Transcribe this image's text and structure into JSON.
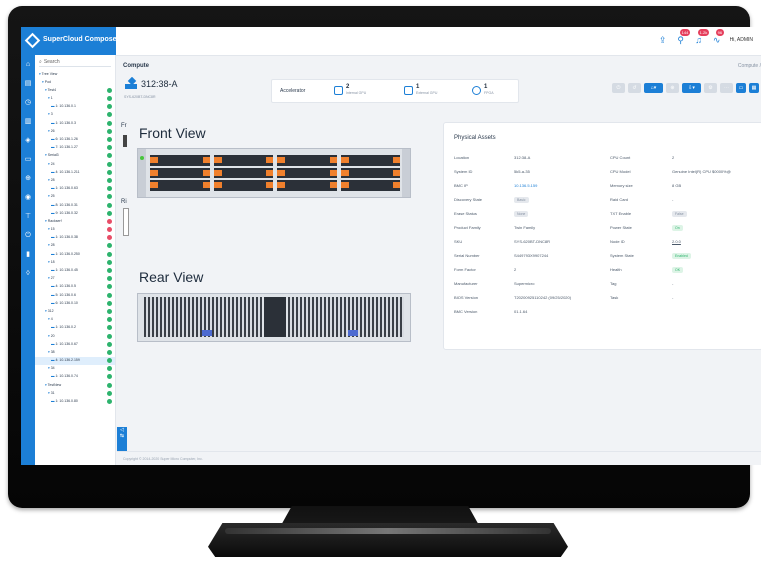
{
  "app": {
    "brand": "SuperCloud Composer",
    "user_label": "Hi, ADMIN"
  },
  "header_badges": {
    "alerts": "144",
    "notifications": "1.2k",
    "tasks": "96"
  },
  "nav_rail_icons": [
    "home-icon",
    "server-icon",
    "clock-icon",
    "report-icon",
    "cube-icon",
    "storage-icon",
    "network-icon",
    "database-icon",
    "switch-icon",
    "power-icon",
    "chart-icon",
    "shield-icon"
  ],
  "tree": {
    "search_placeholder": "Search",
    "items": [
      {
        "label": "Tree View",
        "indent": 0,
        "glyph": "▾",
        "status": "none"
      },
      {
        "label": "Pod",
        "indent": 1,
        "glyph": "▾",
        "status": "none"
      },
      {
        "label": "Test4",
        "indent": 2,
        "glyph": "▾",
        "status": "green"
      },
      {
        "label": "1",
        "indent": 3,
        "glyph": "▾",
        "status": "green"
      },
      {
        "label": "1: 10.136.0.1",
        "indent": 4,
        "glyph": "▬",
        "status": "green"
      },
      {
        "label": "3",
        "indent": 3,
        "glyph": "▾",
        "status": "green"
      },
      {
        "label": "1: 10.136.0.3",
        "indent": 4,
        "glyph": "▬",
        "status": "green"
      },
      {
        "label": "26",
        "indent": 3,
        "glyph": "▾",
        "status": "green"
      },
      {
        "label": "6: 10.136.1.26",
        "indent": 4,
        "glyph": "▬",
        "status": "green"
      },
      {
        "label": "7: 10.136.1.27",
        "indent": 4,
        "glyph": "▬",
        "status": "green"
      },
      {
        "label": "Serial3",
        "indent": 2,
        "glyph": "▾",
        "status": "green"
      },
      {
        "label": "24",
        "indent": 3,
        "glyph": "▾",
        "status": "green"
      },
      {
        "label": "4: 10.136.1.211",
        "indent": 4,
        "glyph": "▬",
        "status": "green"
      },
      {
        "label": "28",
        "indent": 3,
        "glyph": "▾",
        "status": "green"
      },
      {
        "label": "1: 10.136.0.63",
        "indent": 4,
        "glyph": "▬",
        "status": "green"
      },
      {
        "label": "25",
        "indent": 3,
        "glyph": "▾",
        "status": "green"
      },
      {
        "label": "8: 10.136.0.31",
        "indent": 4,
        "glyph": "▬",
        "status": "green"
      },
      {
        "label": "9: 10.136.0.32",
        "indent": 4,
        "glyph": "▬",
        "status": "green"
      },
      {
        "label": "Rackserf",
        "indent": 2,
        "glyph": "▾",
        "status": "red"
      },
      {
        "label": "15",
        "indent": 3,
        "glyph": "▾",
        "status": "red"
      },
      {
        "label": "1: 10.136.0.38",
        "indent": 4,
        "glyph": "▬",
        "status": "red"
      },
      {
        "label": "28",
        "indent": 3,
        "glyph": "▾",
        "status": "green"
      },
      {
        "label": "1: 10.136.0.250",
        "indent": 4,
        "glyph": "▬",
        "status": "green"
      },
      {
        "label": "18",
        "indent": 3,
        "glyph": "▾",
        "status": "green"
      },
      {
        "label": "1: 10.136.0.45",
        "indent": 4,
        "glyph": "▬",
        "status": "green"
      },
      {
        "label": "27",
        "indent": 3,
        "glyph": "▾",
        "status": "green"
      },
      {
        "label": "4: 10.136.0.5",
        "indent": 4,
        "glyph": "▬",
        "status": "green"
      },
      {
        "label": "5: 10.136.0.6",
        "indent": 4,
        "glyph": "▬",
        "status": "green"
      },
      {
        "label": "6: 10.136.0.10",
        "indent": 4,
        "glyph": "▬",
        "status": "green"
      },
      {
        "label": "312",
        "indent": 2,
        "glyph": "▾",
        "status": "green"
      },
      {
        "label": "4",
        "indent": 3,
        "glyph": "▾",
        "status": "green"
      },
      {
        "label": "1: 10.136.0.2",
        "indent": 4,
        "glyph": "▬",
        "status": "green"
      },
      {
        "label": "20",
        "indent": 3,
        "glyph": "▾",
        "status": "green"
      },
      {
        "label": "1: 10.136.0.67",
        "indent": 4,
        "glyph": "▬",
        "status": "green"
      },
      {
        "label": "38",
        "indent": 3,
        "glyph": "▾",
        "status": "green"
      },
      {
        "label": "4: 10.136.2.159",
        "indent": 4,
        "glyph": "▬",
        "status": "green",
        "selected": true
      },
      {
        "label": "34",
        "indent": 3,
        "glyph": "▾",
        "status": "green"
      },
      {
        "label": "1: 10.136.0.74",
        "indent": 4,
        "glyph": "▬",
        "status": "green"
      },
      {
        "label": "TestNew",
        "indent": 2,
        "glyph": "▾",
        "status": "green"
      },
      {
        "label": "31",
        "indent": 3,
        "glyph": "▾",
        "status": "green"
      },
      {
        "label": "1: 10.136.0.80",
        "indent": 4,
        "glyph": "▬",
        "status": "green"
      }
    ]
  },
  "main": {
    "section": "Compute",
    "breadcrumb": "Compute /",
    "node_name": "312:38-A",
    "node_sub": "SYS-620BT-DNC8R",
    "accelerator": {
      "label": "Accelerator",
      "items": [
        {
          "count": "2",
          "sub": "Internal GPU"
        },
        {
          "count": "1",
          "sub": "External GPU"
        },
        {
          "count": "1",
          "sub": "FPGA"
        }
      ]
    },
    "views": {
      "front_tab": "Fr",
      "rear_tab": "Ri",
      "front": "Front View",
      "rear": "Rear View"
    },
    "assets": {
      "title": "Physical Assets",
      "left": [
        {
          "k": "Location",
          "v": "312:38-A",
          "type": "text"
        },
        {
          "k": "System ID",
          "v": "5k5-a-35",
          "type": "text"
        },
        {
          "k": "BMC IP",
          "v": "10.136.5.159",
          "type": "link"
        },
        {
          "k": "Discovery State",
          "v": "Basic",
          "type": "gray"
        },
        {
          "k": "Erase Status",
          "v": "None",
          "type": "gray"
        },
        {
          "k": "Product Family",
          "v": "Twin Family",
          "type": "text"
        },
        {
          "k": "SKU",
          "v": "SYS-620BT-DNC8R",
          "type": "text"
        },
        {
          "k": "Serial Number",
          "v": "S449793X9907244",
          "type": "text"
        },
        {
          "k": "Form Factor",
          "v": "2",
          "type": "text"
        },
        {
          "k": "Manufacturer",
          "v": "Supermicro",
          "type": "text"
        },
        {
          "k": "BIOS Version",
          "v": "T20200925110242 (09/25/2020)",
          "type": "text"
        },
        {
          "k": "BMC Version",
          "v": "01.1.64",
          "type": "text"
        }
      ],
      "right": [
        {
          "k": "CPU Count",
          "v": "2",
          "type": "text"
        },
        {
          "k": "CPU Model",
          "v": "Genuine Intel(R) CPU $0000%@",
          "type": "text"
        },
        {
          "k": "Memory size",
          "v": "8 GB",
          "type": "text"
        },
        {
          "k": "Raid Card",
          "v": "-",
          "type": "text"
        },
        {
          "k": "TXT Enable",
          "v": "False",
          "type": "gray"
        },
        {
          "k": "Power State",
          "v": "On",
          "type": "green"
        },
        {
          "k": "Node ID",
          "v": "2.0.0",
          "type": "underline"
        },
        {
          "k": "System State",
          "v": "Enabled",
          "type": "green"
        },
        {
          "k": "Health",
          "v": "OK",
          "type": "green"
        },
        {
          "k": "Tag",
          "v": "-",
          "type": "text"
        },
        {
          "k": "Task",
          "v": "-",
          "type": "text"
        }
      ]
    },
    "footer": "Copyright © 2014-2020 Super Micro Computer, Inc."
  },
  "colors": {
    "primary": "#1c7fd6",
    "ok": "#2db36d",
    "alert": "#e84d67",
    "drive": "#f0802d"
  }
}
